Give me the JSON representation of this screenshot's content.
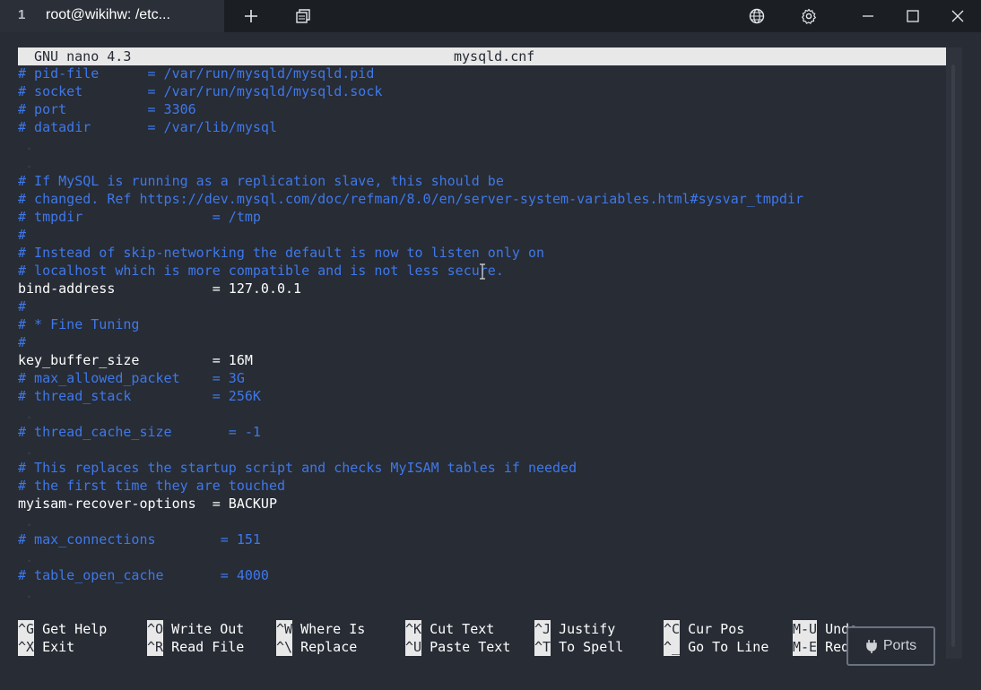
{
  "tab": {
    "number": "1",
    "title": "root@wikihw: /etc..."
  },
  "window": {
    "icons": [
      "plus-icon",
      "duplicate-icon",
      "globe-icon",
      "gear-icon",
      "minimize-icon",
      "maximize-icon",
      "close-icon"
    ]
  },
  "nano": {
    "version": "GNU nano 4.3",
    "filename": "mysqld.cnf"
  },
  "lines": [
    {
      "text": "# pid-file      = /var/run/mysqld/mysqld.pid",
      "kind": "cmt"
    },
    {
      "text": "# socket        = /var/run/mysqld/mysqld.sock",
      "kind": "cmt"
    },
    {
      "text": "# port          = 3306",
      "kind": "cmt"
    },
    {
      "text": "# datadir       = /var/lib/mysql",
      "kind": "cmt"
    },
    {
      "text": "",
      "kind": "dot"
    },
    {
      "text": "",
      "kind": "dot"
    },
    {
      "text": "# If MySQL is running as a replication slave, this should be",
      "kind": "cmt"
    },
    {
      "text": "# changed. Ref https://dev.mysql.com/doc/refman/8.0/en/server-system-variables.html#sysvar_tmpdir",
      "kind": "cmt"
    },
    {
      "text": "# tmpdir                = /tmp",
      "kind": "cmt"
    },
    {
      "text": "#",
      "kind": "cmt"
    },
    {
      "text": "# Instead of skip-networking the default is now to listen only on",
      "kind": "cmt"
    },
    {
      "text": "# localhost which is more compatible and is not less secure.",
      "kind": "cmt"
    },
    {
      "text": "bind-address            = 127.0.0.1",
      "kind": "cfg"
    },
    {
      "text": "#",
      "kind": "cmt"
    },
    {
      "text": "# * Fine Tuning",
      "kind": "cmt"
    },
    {
      "text": "#",
      "kind": "cmt"
    },
    {
      "text": "key_buffer_size         = 16M",
      "kind": "cfg"
    },
    {
      "text": "# max_allowed_packet    = 3G",
      "kind": "cmt"
    },
    {
      "text": "# thread_stack          = 256K",
      "kind": "cmt"
    },
    {
      "text": "",
      "kind": "dot"
    },
    {
      "text": "# thread_cache_size       = -1",
      "kind": "cmt"
    },
    {
      "text": "",
      "kind": "dot"
    },
    {
      "text": "# This replaces the startup script and checks MyISAM tables if needed",
      "kind": "cmt"
    },
    {
      "text": "# the first time they are touched",
      "kind": "cmt"
    },
    {
      "text": "myisam-recover-options  = BACKUP",
      "kind": "cfg"
    },
    {
      "text": "",
      "kind": "dot"
    },
    {
      "text": "# max_connections        = 151",
      "kind": "cmt"
    },
    {
      "text": "",
      "kind": "dot"
    },
    {
      "text": "# table_open_cache       = 4000",
      "kind": "cmt"
    },
    {
      "text": "",
      "kind": "dot"
    }
  ],
  "shortcuts": [
    [
      {
        "key": "^G",
        "label": "Get Help"
      },
      {
        "key": "^X",
        "label": "Exit"
      }
    ],
    [
      {
        "key": "^O",
        "label": "Write Out"
      },
      {
        "key": "^R",
        "label": "Read File"
      }
    ],
    [
      {
        "key": "^W",
        "label": "Where Is"
      },
      {
        "key": "^\\",
        "label": "Replace"
      }
    ],
    [
      {
        "key": "^K",
        "label": "Cut Text"
      },
      {
        "key": "^U",
        "label": "Paste Text"
      }
    ],
    [
      {
        "key": "^J",
        "label": "Justify"
      },
      {
        "key": "^T",
        "label": "To Spell"
      }
    ],
    [
      {
        "key": "^C",
        "label": "Cur Pos"
      },
      {
        "key": "^_",
        "label": "Go To Line"
      }
    ],
    [
      {
        "key": "M-U",
        "label": "Undo"
      },
      {
        "key": "M-E",
        "label": "Redo"
      }
    ]
  ],
  "ports_button": {
    "label": "Ports"
  },
  "colors": {
    "comment": "#3f78ea",
    "config": "#ffffff",
    "header_bg": "#e8e8e8",
    "terminal_bg": "#272c35"
  }
}
